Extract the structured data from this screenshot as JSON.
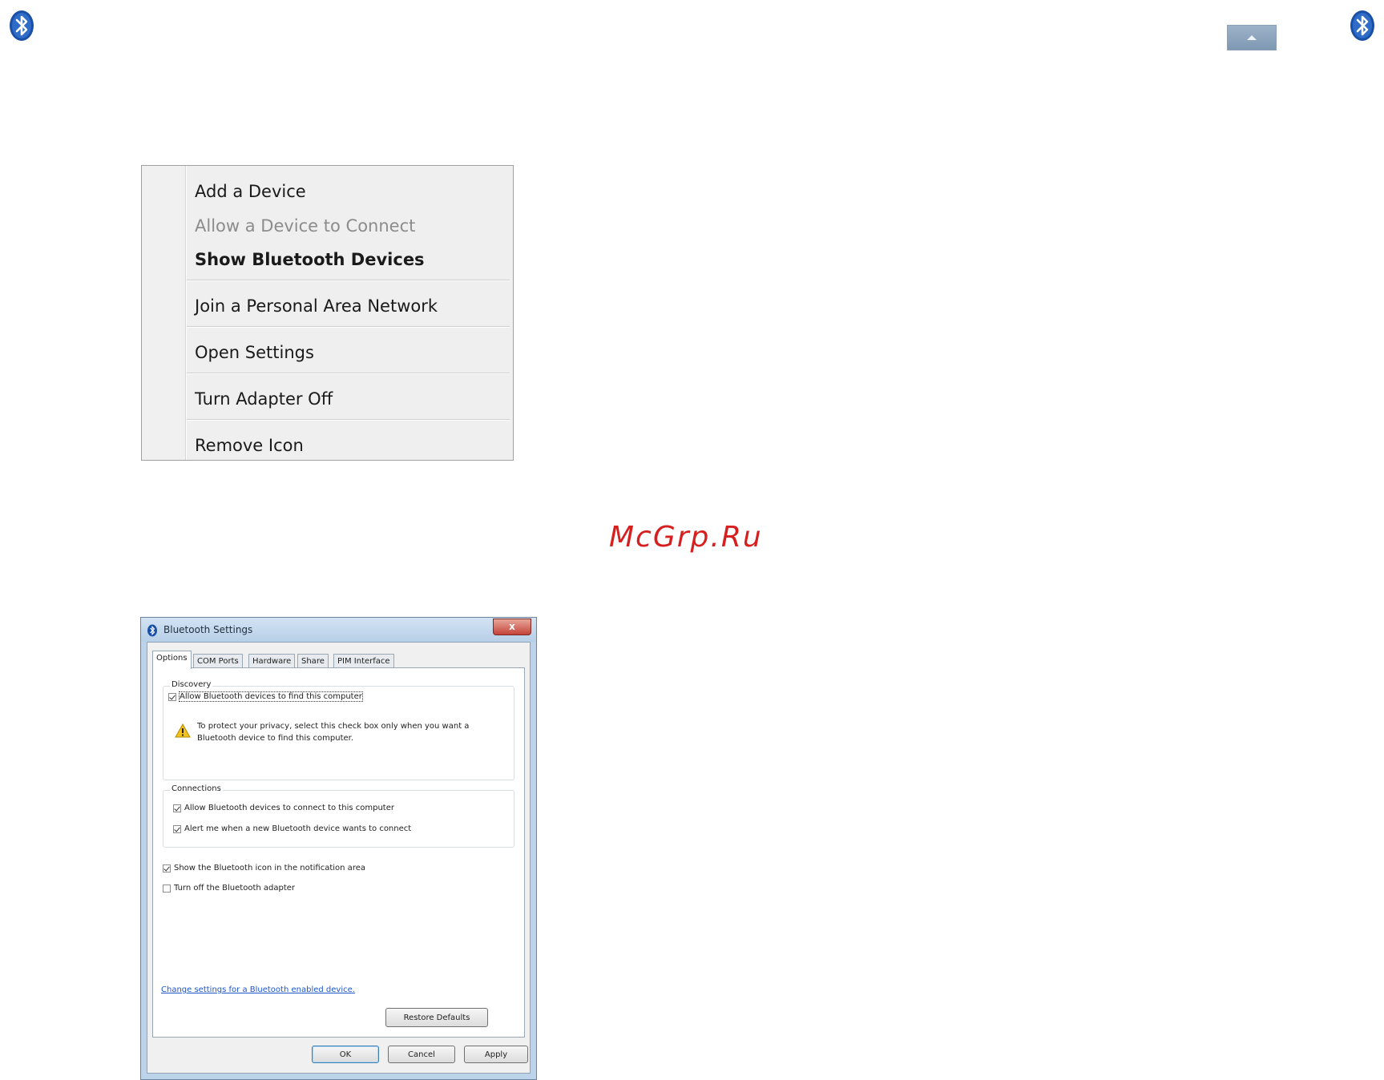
{
  "tray": {
    "left_icon": "bluetooth-icon",
    "chevron_icon": "chevron-up-icon",
    "right_icon": "bluetooth-icon",
    "bluetooth_color": "#1a4fa6"
  },
  "context_menu": {
    "items": [
      {
        "label": "Add a Device",
        "state": "enabled"
      },
      {
        "label": "Allow a Device to Connect",
        "state": "disabled"
      },
      {
        "label": "Show Bluetooth Devices",
        "state": "default"
      },
      {
        "label": "Join a Personal Area Network",
        "state": "enabled"
      },
      {
        "label": "Open Settings",
        "state": "enabled"
      },
      {
        "label": "Turn Adapter Off",
        "state": "enabled"
      },
      {
        "label": "Remove Icon",
        "state": "enabled"
      }
    ]
  },
  "watermark": "McGrp.Ru",
  "dialog": {
    "title": "Bluetooth Settings",
    "close_label": "x",
    "tabs": [
      "Options",
      "COM Ports",
      "Hardware",
      "Share",
      "PIM Interface"
    ],
    "active_tab": "Options",
    "discovery": {
      "label": "Discovery",
      "allow_find": {
        "label": "Allow Bluetooth devices to find this computer",
        "checked": true
      },
      "warning": "To protect your privacy, select this check box only when you want a Bluetooth device to find this computer."
    },
    "connections": {
      "label": "Connections",
      "allow_connect": {
        "label": "Allow Bluetooth devices to connect to this computer",
        "checked": true
      },
      "alert_me": {
        "label": "Alert me when a new Bluetooth device wants to connect",
        "checked": true
      }
    },
    "show_icon": {
      "label": "Show the Bluetooth icon in the notification area",
      "checked": true
    },
    "turn_off": {
      "label": "Turn off the Bluetooth adapter",
      "checked": false
    },
    "link": "Change settings for a Bluetooth enabled device.",
    "restore_defaults": "Restore Defaults",
    "ok": "OK",
    "cancel": "Cancel",
    "apply": "Apply"
  }
}
